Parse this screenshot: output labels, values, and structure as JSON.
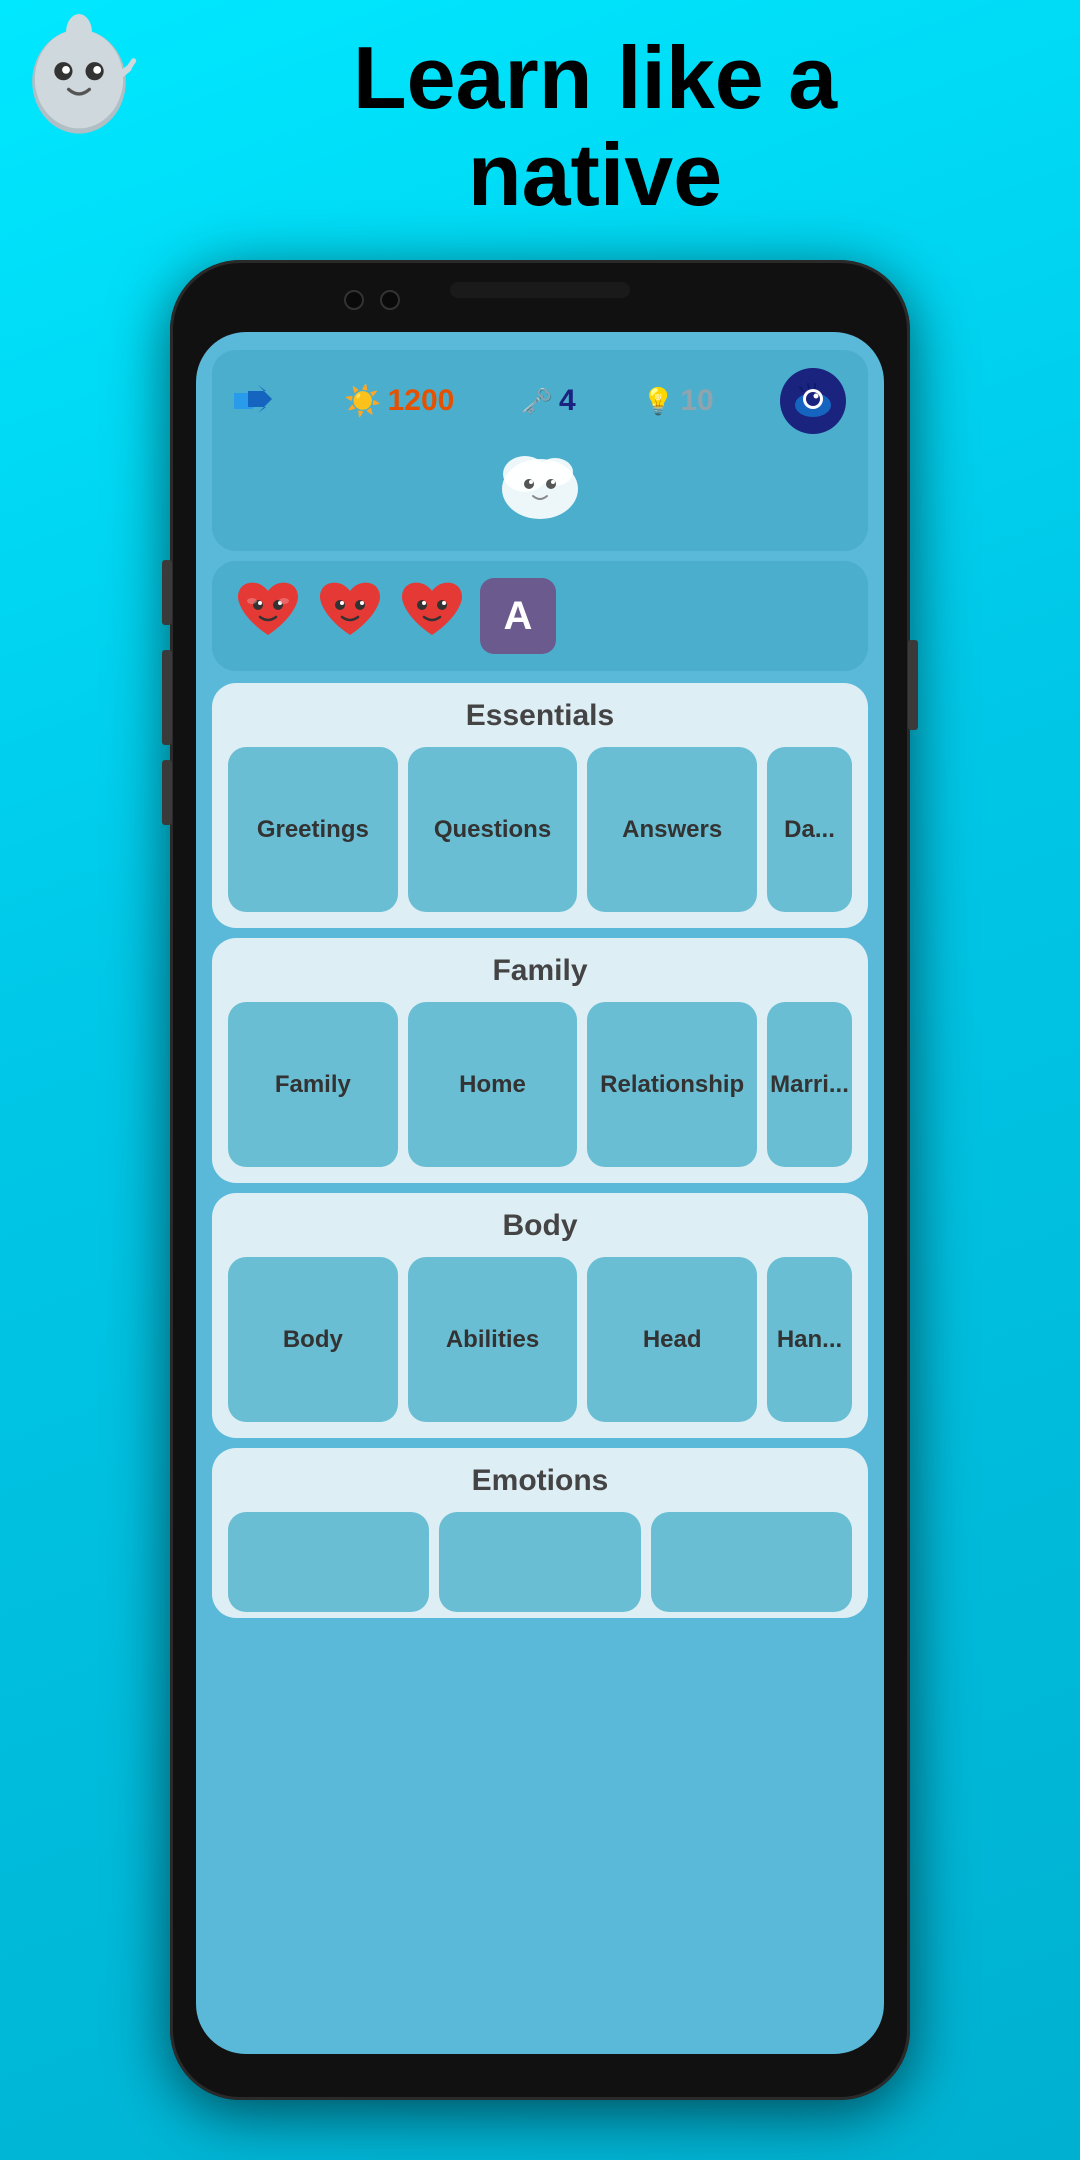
{
  "header": {
    "tagline_line1": "Learn like a",
    "tagline_line2": "native"
  },
  "stats": {
    "xp": "1200",
    "keys": "4",
    "gems": "10"
  },
  "lives": {
    "hearts": [
      "❤️",
      "❤️",
      "❤️"
    ],
    "letter": "A"
  },
  "sections": [
    {
      "id": "essentials",
      "title": "Essentials",
      "cards": [
        "Greetings",
        "Questions",
        "Answers",
        "Da..."
      ]
    },
    {
      "id": "family",
      "title": "Family",
      "cards": [
        "Family",
        "Home",
        "Relationship",
        "Marri..."
      ]
    },
    {
      "id": "body",
      "title": "Body",
      "cards": [
        "Body",
        "Abilities",
        "Head",
        "Han..."
      ]
    },
    {
      "id": "emotions",
      "title": "Emotions",
      "cards": []
    }
  ]
}
